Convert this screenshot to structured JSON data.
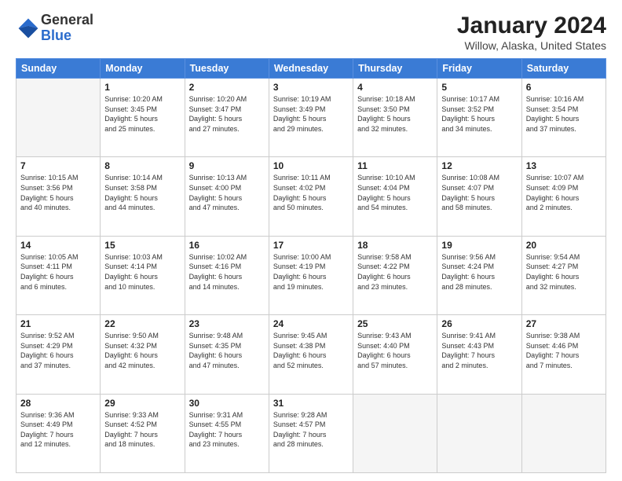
{
  "logo": {
    "general": "General",
    "blue": "Blue"
  },
  "title": "January 2024",
  "subtitle": "Willow, Alaska, United States",
  "days_of_week": [
    "Sunday",
    "Monday",
    "Tuesday",
    "Wednesday",
    "Thursday",
    "Friday",
    "Saturday"
  ],
  "weeks": [
    [
      {
        "day": null,
        "info": null
      },
      {
        "day": "1",
        "info": "Sunrise: 10:20 AM\nSunset: 3:45 PM\nDaylight: 5 hours\nand 25 minutes."
      },
      {
        "day": "2",
        "info": "Sunrise: 10:20 AM\nSunset: 3:47 PM\nDaylight: 5 hours\nand 27 minutes."
      },
      {
        "day": "3",
        "info": "Sunrise: 10:19 AM\nSunset: 3:49 PM\nDaylight: 5 hours\nand 29 minutes."
      },
      {
        "day": "4",
        "info": "Sunrise: 10:18 AM\nSunset: 3:50 PM\nDaylight: 5 hours\nand 32 minutes."
      },
      {
        "day": "5",
        "info": "Sunrise: 10:17 AM\nSunset: 3:52 PM\nDaylight: 5 hours\nand 34 minutes."
      },
      {
        "day": "6",
        "info": "Sunrise: 10:16 AM\nSunset: 3:54 PM\nDaylight: 5 hours\nand 37 minutes."
      }
    ],
    [
      {
        "day": "7",
        "info": "Sunrise: 10:15 AM\nSunset: 3:56 PM\nDaylight: 5 hours\nand 40 minutes."
      },
      {
        "day": "8",
        "info": "Sunrise: 10:14 AM\nSunset: 3:58 PM\nDaylight: 5 hours\nand 44 minutes."
      },
      {
        "day": "9",
        "info": "Sunrise: 10:13 AM\nSunset: 4:00 PM\nDaylight: 5 hours\nand 47 minutes."
      },
      {
        "day": "10",
        "info": "Sunrise: 10:11 AM\nSunset: 4:02 PM\nDaylight: 5 hours\nand 50 minutes."
      },
      {
        "day": "11",
        "info": "Sunrise: 10:10 AM\nSunset: 4:04 PM\nDaylight: 5 hours\nand 54 minutes."
      },
      {
        "day": "12",
        "info": "Sunrise: 10:08 AM\nSunset: 4:07 PM\nDaylight: 5 hours\nand 58 minutes."
      },
      {
        "day": "13",
        "info": "Sunrise: 10:07 AM\nSunset: 4:09 PM\nDaylight: 6 hours\nand 2 minutes."
      }
    ],
    [
      {
        "day": "14",
        "info": "Sunrise: 10:05 AM\nSunset: 4:11 PM\nDaylight: 6 hours\nand 6 minutes."
      },
      {
        "day": "15",
        "info": "Sunrise: 10:03 AM\nSunset: 4:14 PM\nDaylight: 6 hours\nand 10 minutes."
      },
      {
        "day": "16",
        "info": "Sunrise: 10:02 AM\nSunset: 4:16 PM\nDaylight: 6 hours\nand 14 minutes."
      },
      {
        "day": "17",
        "info": "Sunrise: 10:00 AM\nSunset: 4:19 PM\nDaylight: 6 hours\nand 19 minutes."
      },
      {
        "day": "18",
        "info": "Sunrise: 9:58 AM\nSunset: 4:22 PM\nDaylight: 6 hours\nand 23 minutes."
      },
      {
        "day": "19",
        "info": "Sunrise: 9:56 AM\nSunset: 4:24 PM\nDaylight: 6 hours\nand 28 minutes."
      },
      {
        "day": "20",
        "info": "Sunrise: 9:54 AM\nSunset: 4:27 PM\nDaylight: 6 hours\nand 32 minutes."
      }
    ],
    [
      {
        "day": "21",
        "info": "Sunrise: 9:52 AM\nSunset: 4:29 PM\nDaylight: 6 hours\nand 37 minutes."
      },
      {
        "day": "22",
        "info": "Sunrise: 9:50 AM\nSunset: 4:32 PM\nDaylight: 6 hours\nand 42 minutes."
      },
      {
        "day": "23",
        "info": "Sunrise: 9:48 AM\nSunset: 4:35 PM\nDaylight: 6 hours\nand 47 minutes."
      },
      {
        "day": "24",
        "info": "Sunrise: 9:45 AM\nSunset: 4:38 PM\nDaylight: 6 hours\nand 52 minutes."
      },
      {
        "day": "25",
        "info": "Sunrise: 9:43 AM\nSunset: 4:40 PM\nDaylight: 6 hours\nand 57 minutes."
      },
      {
        "day": "26",
        "info": "Sunrise: 9:41 AM\nSunset: 4:43 PM\nDaylight: 7 hours\nand 2 minutes."
      },
      {
        "day": "27",
        "info": "Sunrise: 9:38 AM\nSunset: 4:46 PM\nDaylight: 7 hours\nand 7 minutes."
      }
    ],
    [
      {
        "day": "28",
        "info": "Sunrise: 9:36 AM\nSunset: 4:49 PM\nDaylight: 7 hours\nand 12 minutes."
      },
      {
        "day": "29",
        "info": "Sunrise: 9:33 AM\nSunset: 4:52 PM\nDaylight: 7 hours\nand 18 minutes."
      },
      {
        "day": "30",
        "info": "Sunrise: 9:31 AM\nSunset: 4:55 PM\nDaylight: 7 hours\nand 23 minutes."
      },
      {
        "day": "31",
        "info": "Sunrise: 9:28 AM\nSunset: 4:57 PM\nDaylight: 7 hours\nand 28 minutes."
      },
      {
        "day": null,
        "info": null
      },
      {
        "day": null,
        "info": null
      },
      {
        "day": null,
        "info": null
      }
    ]
  ]
}
